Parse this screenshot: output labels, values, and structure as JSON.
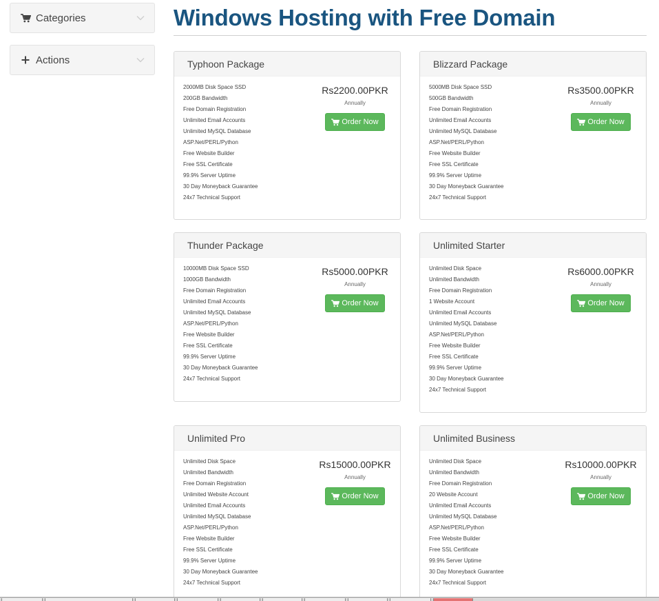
{
  "sidebar": {
    "categories": {
      "label": "Categories",
      "icon": "cart-icon"
    },
    "actions": {
      "label": "Actions",
      "icon": "plus-icon"
    }
  },
  "page": {
    "title": "Windows Hosting with Free Domain"
  },
  "order_label": "Order Now",
  "colors": {
    "title": "#1a5580",
    "button": "#5cb85c"
  },
  "packages": [
    {
      "name": "Typhoon Package",
      "price": "Rs2200.00PKR",
      "cycle": "Annually",
      "features": [
        "2000MB Disk Space SSD",
        "200GB Bandwidth",
        "Free Domain Registration",
        "Unlimited Email Accounts",
        "Unlimited MySQL Database",
        "ASP.Net/PERL/Python",
        "Free Website Builder",
        "Free SSL Certificate",
        "99.9% Server Uptime",
        "30 Day Moneyback Guarantee",
        "24x7 Technical Support"
      ]
    },
    {
      "name": "Blizzard Package",
      "price": "Rs3500.00PKR",
      "cycle": "Annually",
      "features": [
        "5000MB Disk Space SSD",
        "500GB Bandwidth",
        "Free Domain Registration",
        "Unlimited Email Accounts",
        "Unlimited MySQL Database",
        "ASP.Net/PERL/Python",
        "Free Website Builder",
        "Free SSL Certificate",
        "99.9% Server Uptime",
        "30 Day Moneyback Guarantee",
        "24x7 Technical Support"
      ]
    },
    {
      "name": "Thunder Package",
      "price": "Rs5000.00PKR",
      "cycle": "Annually",
      "features": [
        "10000MB Disk Space SSD",
        "1000GB Bandwidth",
        "Free Domain Registration",
        "Unlimited Email Accounts",
        "Unlimited MySQL Database",
        "ASP.Net/PERL/Python",
        "Free Website Builder",
        "Free SSL Certificate",
        "99.9% Server Uptime",
        "30 Day Moneyback Guarantee",
        "24x7 Technical Support"
      ]
    },
    {
      "name": "Unlimited Starter",
      "price": "Rs6000.00PKR",
      "cycle": "Annually",
      "features": [
        "Unlimited Disk Space",
        "Unlimited Bandwidth",
        "Free Domain Registration",
        "1 Website Account",
        "Unlimited Email Accounts",
        "Unlimited MySQL Database",
        "ASP.Net/PERL/Python",
        "Free Website Builder",
        "Free SSL Certificate",
        "99.9% Server Uptime",
        "30 Day Moneyback Guarantee",
        "24x7 Technical Support"
      ]
    },
    {
      "name": "Unlimited Pro",
      "price": "Rs15000.00PKR",
      "cycle": "Annually",
      "features": [
        "Unlimited Disk Space",
        "Unlimited Bandwidth",
        "Free Domain Registration",
        "Unlimited Website Account",
        "Unlimited Email Accounts",
        "Unlimited MySQL Database",
        "ASP.Net/PERL/Python",
        "Free Website Builder",
        "Free SSL Certificate",
        "99.9% Server Uptime",
        "30 Day Moneyback Guarantee",
        "24x7 Technical Support"
      ]
    },
    {
      "name": "Unlimited Business",
      "price": "Rs10000.00PKR",
      "cycle": "Annually",
      "features": [
        "Unlimited Disk Space",
        "Unlimited Bandwidth",
        "Free Domain Registration",
        "20 Website Account",
        "Unlimited Email Accounts",
        "Unlimited MySQL Database",
        "ASP.Net/PERL/Python",
        "Free Website Builder",
        "Free SSL Certificate",
        "99.9% Server Uptime",
        "30 Day Moneyback Guarantee",
        "24x7 Technical Support"
      ]
    }
  ]
}
